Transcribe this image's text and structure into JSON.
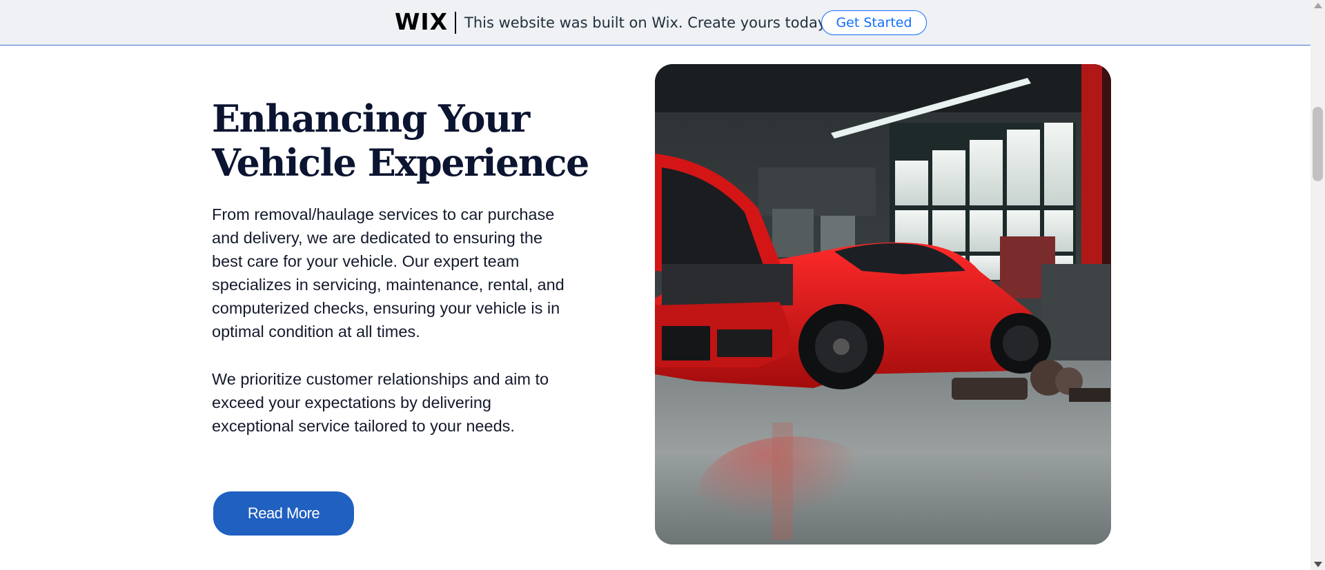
{
  "banner": {
    "logo": "WIX",
    "message": "This website was built on Wix. Create yours today.",
    "cta_label": "Get Started"
  },
  "main": {
    "title": "Enhancing Your Vehicle Experience",
    "paragraph_1": "From removal/haulage services to car purchase and delivery, we are dedicated to ensuring the best care for your vehicle. Our expert team specializes in servicing, maintenance, rental, and computerized checks, ensuring your vehicle is in optimal condition at all times.",
    "paragraph_2": "We prioritize customer relationships and aim to exceed your expectations by delivering exceptional service tailored to your needs.",
    "button_label": "Read More"
  },
  "colors": {
    "accent": "#2060c0",
    "banner_bg": "#eff1f4",
    "heading": "#0b1430"
  },
  "icons": [
    "wix-logo-icon",
    "scroll-up-arrow-icon",
    "scroll-down-arrow-icon"
  ]
}
